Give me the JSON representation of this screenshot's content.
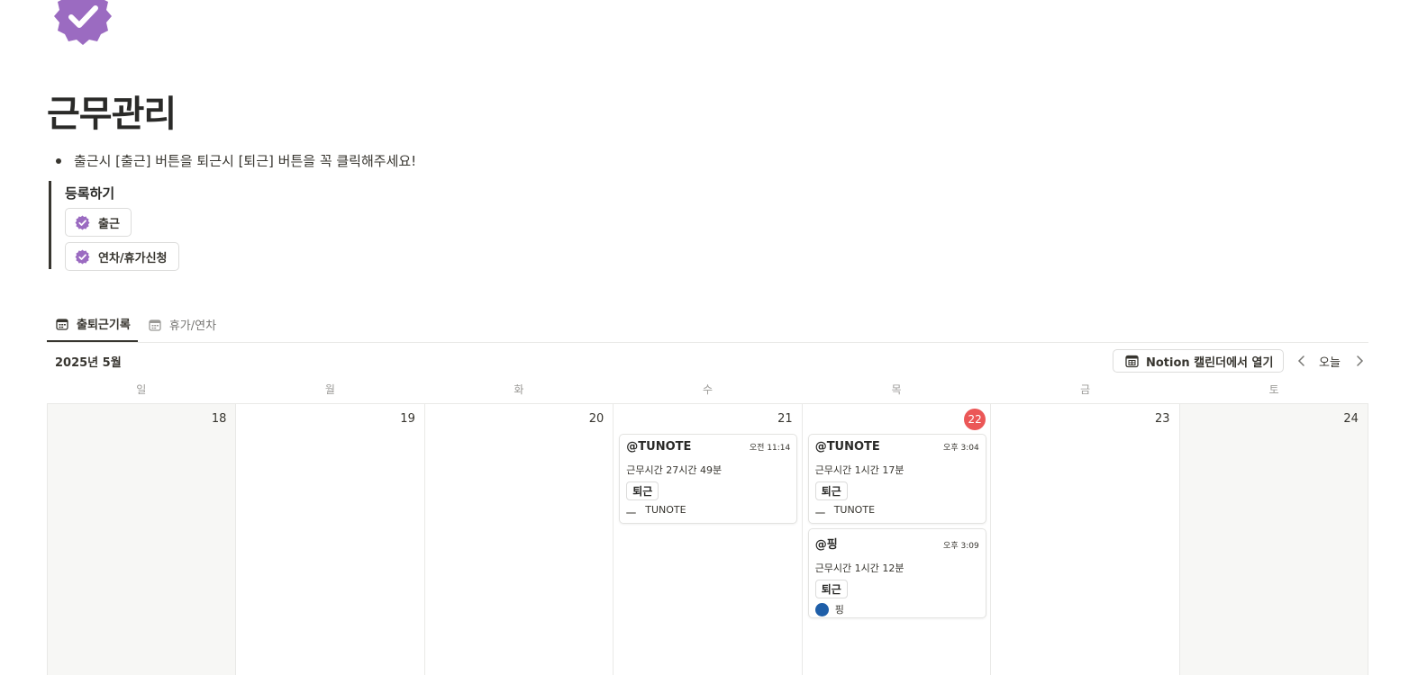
{
  "page": {
    "title": "근무관리",
    "icon": "verified-badge-icon",
    "bullet": "출근시 [출근] 버튼을 퇴근시 [퇴근] 버튼을 꼭 클릭해주세요!"
  },
  "callout": {
    "heading": "등록하기",
    "buttons": [
      {
        "label": "출근",
        "icon": "verified-badge-icon"
      },
      {
        "label": "연차/휴가신청",
        "icon": "verified-badge-icon"
      }
    ]
  },
  "tabs": [
    {
      "label": "출퇴근기록",
      "icon": "calendar-icon",
      "active": true
    },
    {
      "label": "휴가/연차",
      "icon": "calendar-icon",
      "active": false
    }
  ],
  "calendar": {
    "month_label": "2025년 5월",
    "open_button": "Notion 캘린더에서 열기",
    "today_label": "오늘",
    "weekdays": [
      "일",
      "월",
      "화",
      "수",
      "목",
      "금",
      "토"
    ],
    "days": [
      "18",
      "19",
      "20",
      "21",
      "22",
      "23",
      "24"
    ],
    "today_index": 4,
    "events": {
      "wed": [
        {
          "name": "@TUNOTE",
          "time": "오전 11:14",
          "duration": "근무시간 27시간 49분",
          "status": "퇴근",
          "person": "TUNOTE"
        }
      ],
      "thu": [
        {
          "name": "@TUNOTE",
          "time": "오후 3:04",
          "duration": "근무시간 1시간 17분",
          "status": "퇴근",
          "person": "TUNOTE"
        },
        {
          "name": "@핑",
          "time": "오후 3:09",
          "duration": "근무시간 1시간 12분",
          "status": "퇴근",
          "person": "핑"
        }
      ]
    }
  },
  "colors": {
    "accent": "#9b6bc1",
    "today": "#eb5757",
    "avatar": "#1e5ea8"
  }
}
